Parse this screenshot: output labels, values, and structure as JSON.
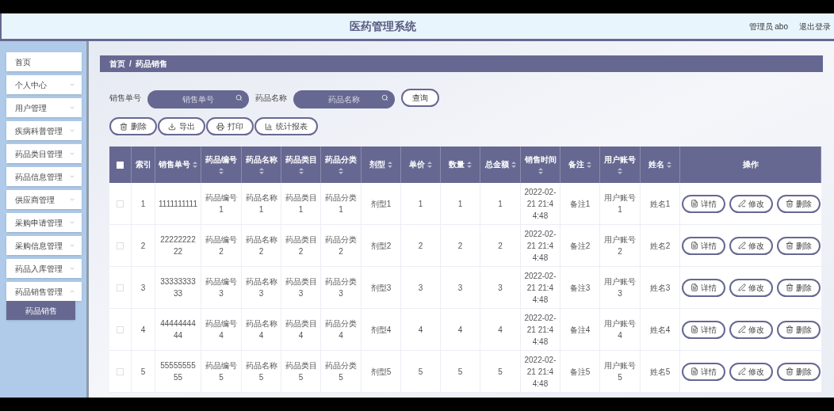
{
  "header": {
    "title": "医药管理系统",
    "user": "管理员 abo",
    "logout": "退出登录"
  },
  "sidebar": {
    "items": [
      {
        "kind": "link",
        "label": "首页"
      },
      {
        "kind": "menu",
        "label": "个人中心",
        "expanded": false
      },
      {
        "kind": "menu",
        "label": "用户管理",
        "expanded": false
      },
      {
        "kind": "menu",
        "label": "疾病科普管理",
        "expanded": false
      },
      {
        "kind": "menu",
        "label": "药品类目管理",
        "expanded": false
      },
      {
        "kind": "menu",
        "label": "药品信息管理",
        "expanded": false
      },
      {
        "kind": "menu",
        "label": "供应商管理",
        "expanded": false
      },
      {
        "kind": "menu",
        "label": "采购申请管理",
        "expanded": false
      },
      {
        "kind": "menu",
        "label": "采购信息管理",
        "expanded": false
      },
      {
        "kind": "menu",
        "label": "药品入库管理",
        "expanded": false
      },
      {
        "kind": "menu",
        "label": "药品销售管理",
        "expanded": true,
        "children": [
          {
            "label": "药品销售",
            "selected": true
          }
        ]
      }
    ]
  },
  "breadcrumb": [
    "首页",
    "/",
    "药品销售"
  ],
  "search": {
    "fields": [
      {
        "label": "销售单号",
        "placeholder": "销售单号"
      },
      {
        "label": "药品名称",
        "placeholder": "药品名称"
      }
    ],
    "button": "查询"
  },
  "toolbar": [
    {
      "kind": "delete",
      "label": "删除"
    },
    {
      "kind": "export",
      "label": "导出"
    },
    {
      "kind": "print",
      "label": "打印"
    },
    {
      "kind": "chart",
      "label": "统计报表"
    }
  ],
  "table": {
    "header_checked": false,
    "columns": [
      {
        "label": "索引",
        "sortable": false
      },
      {
        "label": "销售单号",
        "sortable": true
      },
      {
        "label": "药品编号",
        "sortable": true
      },
      {
        "label": "药品名称",
        "sortable": true
      },
      {
        "label": "药品类目",
        "sortable": true
      },
      {
        "label": "药品分类",
        "sortable": true
      },
      {
        "label": "剂型",
        "sortable": true
      },
      {
        "label": "单价",
        "sortable": true
      },
      {
        "label": "数量",
        "sortable": true
      },
      {
        "label": "总金额",
        "sortable": true
      },
      {
        "label": "销售时间",
        "sortable": true
      },
      {
        "label": "备注",
        "sortable": true
      },
      {
        "label": "用户账号",
        "sortable": true
      },
      {
        "label": "姓名",
        "sortable": true
      },
      {
        "label": "操作",
        "sortable": false
      }
    ],
    "rows": [
      {
        "checked": false,
        "cells": [
          "1",
          "1111111111",
          "药品编号1",
          "药品名称1",
          "药品类目1",
          "药品分类1",
          "剂型1",
          "1",
          "1",
          "1",
          "2022-02-21 21:44:48",
          "备注1",
          "用户账号1",
          "姓名1"
        ],
        "actions": [
          {
            "kind": "detail",
            "label": "详情"
          },
          {
            "kind": "edit",
            "label": "修改"
          },
          {
            "kind": "delete",
            "label": "删除"
          }
        ]
      },
      {
        "checked": false,
        "cells": [
          "2",
          "2222222222",
          "药品编号2",
          "药品名称2",
          "药品类目2",
          "药品分类2",
          "剂型2",
          "2",
          "2",
          "2",
          "2022-02-21 21:44:48",
          "备注2",
          "用户账号2",
          "姓名2"
        ],
        "actions": [
          {
            "kind": "detail",
            "label": "详情"
          },
          {
            "kind": "edit",
            "label": "修改"
          },
          {
            "kind": "delete",
            "label": "删除"
          }
        ]
      },
      {
        "checked": false,
        "cells": [
          "3",
          "3333333333",
          "药品编号3",
          "药品名称3",
          "药品类目3",
          "药品分类3",
          "剂型3",
          "3",
          "3",
          "3",
          "2022-02-21 21:44:48",
          "备注3",
          "用户账号3",
          "姓名3"
        ],
        "actions": [
          {
            "kind": "detail",
            "label": "详情"
          },
          {
            "kind": "edit",
            "label": "修改"
          },
          {
            "kind": "delete",
            "label": "删除"
          }
        ]
      },
      {
        "checked": false,
        "cells": [
          "4",
          "4444444444",
          "药品编号4",
          "药品名称4",
          "药品类目4",
          "药品分类4",
          "剂型4",
          "4",
          "4",
          "4",
          "2022-02-21 21:44:48",
          "备注4",
          "用户账号4",
          "姓名4"
        ],
        "actions": [
          {
            "kind": "detail",
            "label": "详情"
          },
          {
            "kind": "edit",
            "label": "修改"
          },
          {
            "kind": "delete",
            "label": "删除"
          }
        ]
      },
      {
        "checked": false,
        "cells": [
          "5",
          "5555555555",
          "药品编号5",
          "药品名称5",
          "药品类目5",
          "药品分类5",
          "剂型5",
          "5",
          "5",
          "5",
          "2022-02-21 21:44:48",
          "备注5",
          "用户账号5",
          "姓名5"
        ],
        "actions": [
          {
            "kind": "detail",
            "label": "详情"
          },
          {
            "kind": "edit",
            "label": "修改"
          },
          {
            "kind": "delete",
            "label": "删除"
          }
        ]
      }
    ]
  }
}
